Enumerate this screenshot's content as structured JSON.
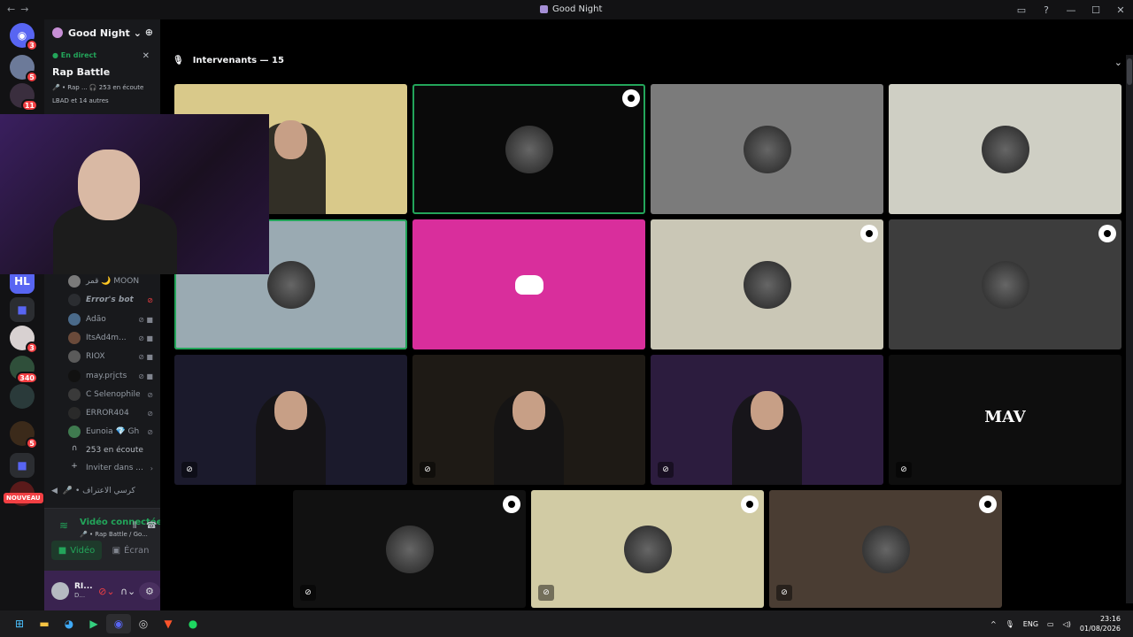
{
  "window": {
    "title": "Good Night"
  },
  "guilds": [
    {
      "name": "discord-home",
      "badge": "3"
    },
    {
      "name": "server-rap",
      "badge": "5"
    },
    {
      "name": "server-gaming",
      "badge": "11"
    },
    {
      "name": "server-hl",
      "badge": ""
    },
    {
      "name": "folder-1",
      "badge": ""
    },
    {
      "name": "server-red",
      "badge": "3"
    },
    {
      "name": "server-green",
      "badge": "340"
    },
    {
      "name": "server-dark",
      "badge": ""
    },
    {
      "name": "server-orange",
      "badge": "5"
    },
    {
      "name": "folder-2",
      "badge": ""
    },
    {
      "name": "server-new",
      "badge": ""
    }
  ],
  "nouveau_label": "NOUVEAU",
  "server": {
    "name": "Good Night"
  },
  "stage": {
    "live_label": "En direct",
    "name": "Rap Battle",
    "meta": "🎤 • Rap ...   🎧 253 en écoute",
    "participants": "LBAD et 14 autres"
  },
  "members": [
    {
      "name": "قمر 🌙 MOON"
    },
    {
      "name": "Error's bot"
    },
    {
      "name": "Adão"
    },
    {
      "name": "ItsAd4m..."
    },
    {
      "name": "RIOX"
    },
    {
      "name": "may.prjcts"
    },
    {
      "name": "C Selenophile"
    },
    {
      "name": "ERROR404"
    },
    {
      "name": "Eunoia 💎 Gh"
    },
    {
      "name": "253 en écoute"
    },
    {
      "name": "Inviter dans ..."
    }
  ],
  "next_channel": "🎤 • كرسي الاعتراف",
  "voice": {
    "status": "Vidéo connectée",
    "sub": "🎤 • Rap Battle / Go...",
    "video_label": "Vidéo",
    "screen_label": "Écran"
  },
  "user": {
    "name": "RI...",
    "status": "D..."
  },
  "main": {
    "speakers_label": "Intervenants — 15",
    "tiles": [
      {
        "kind": "cam",
        "bg": "#d9c98a",
        "speaking": false,
        "mod": false
      },
      {
        "kind": "avatar",
        "bg": "#0a0a0a",
        "speaking": true,
        "mod": true
      },
      {
        "kind": "avatar",
        "bg": "#7b7b7b",
        "speaking": false,
        "mod": false
      },
      {
        "kind": "avatar",
        "bg": "#cfcfc4",
        "speaking": false,
        "mod": false
      },
      {
        "kind": "avatar",
        "bg": "#9aaab2",
        "speaking": true,
        "mod": false
      },
      {
        "kind": "discord",
        "bg": "#d92e9c",
        "speaking": false,
        "mod": false
      },
      {
        "kind": "avatar",
        "bg": "#cac7b6",
        "speaking": false,
        "mod": true
      },
      {
        "kind": "avatar",
        "bg": "#3d3d3d",
        "speaking": false,
        "mod": true
      },
      {
        "kind": "cam",
        "bg": "#1b1a2c",
        "speaking": false,
        "mod": false
      },
      {
        "kind": "cam",
        "bg": "#1e1a15",
        "speaking": false,
        "mod": false
      },
      {
        "kind": "cam",
        "bg": "#2c1c3e",
        "speaking": false,
        "mod": false
      },
      {
        "kind": "logo",
        "bg": "#0e0e0e",
        "speaking": false,
        "mod": false,
        "text": "MAV"
      },
      {
        "kind": "avatar",
        "bg": "#111111",
        "speaking": false,
        "mod": true
      },
      {
        "kind": "avatar",
        "bg": "#d1cba4",
        "speaking": false,
        "mod": true
      },
      {
        "kind": "avatar",
        "bg": "#4a3d33",
        "speaking": false,
        "mod": true
      }
    ]
  },
  "taskbar": {
    "lang": "ENG",
    "time": "23:16",
    "date": "01/08/2026"
  },
  "colors": {
    "accent": "#5865f2",
    "online": "#23a55a",
    "danger": "#f23f43"
  }
}
